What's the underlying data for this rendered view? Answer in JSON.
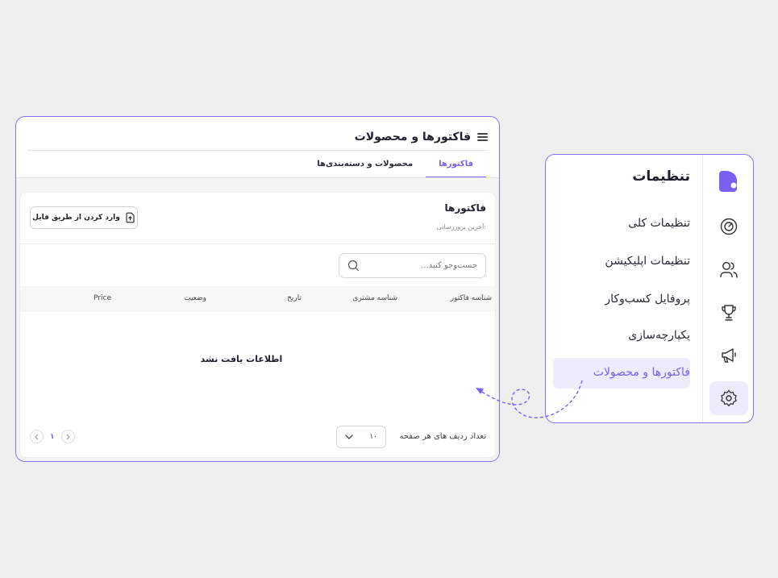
{
  "window": {
    "title": "فاکتورها و محصولات",
    "tabs": [
      {
        "label": "فاکتورها",
        "active": true
      },
      {
        "label": "محصولات و دسته‌بندی‌ها",
        "active": false
      }
    ],
    "card": {
      "title": "فاکتورها",
      "subtitle": "آخرین بروزرسانی:",
      "import_label": "وارد کردن از طریق فایل",
      "search_placeholder": "جست‌وجو کنید...",
      "columns": [
        "شناسه فاکتور",
        "شناسه مشتری",
        "تاریخ",
        "وضعیت",
        "Price"
      ],
      "empty_text": "اطلاعات یافت نشد",
      "rows_per_page_label": "تعداد ردیف های هر صفحه",
      "rows_per_page_value": "۱۰",
      "current_page": "۱"
    }
  },
  "settings": {
    "title": "تنظیمات",
    "menu": [
      {
        "label": "تنظیمات کلی",
        "active": false
      },
      {
        "label": "تنظیمات اپلیکیشن",
        "active": false
      },
      {
        "label": "پروفایل کسب‌وکار",
        "active": false
      },
      {
        "label": "یکپارچه‌سازی",
        "active": false
      },
      {
        "label": "فاکتورها و محصولات",
        "active": true
      }
    ],
    "rail_icons": [
      "logo-icon",
      "gauge-icon",
      "users-icon",
      "trophy-icon",
      "megaphone-icon",
      "gear-icon"
    ]
  },
  "colors": {
    "accent": "#7b5ff0",
    "accent_light": "#eeebfd",
    "border": "#8a70f0"
  }
}
